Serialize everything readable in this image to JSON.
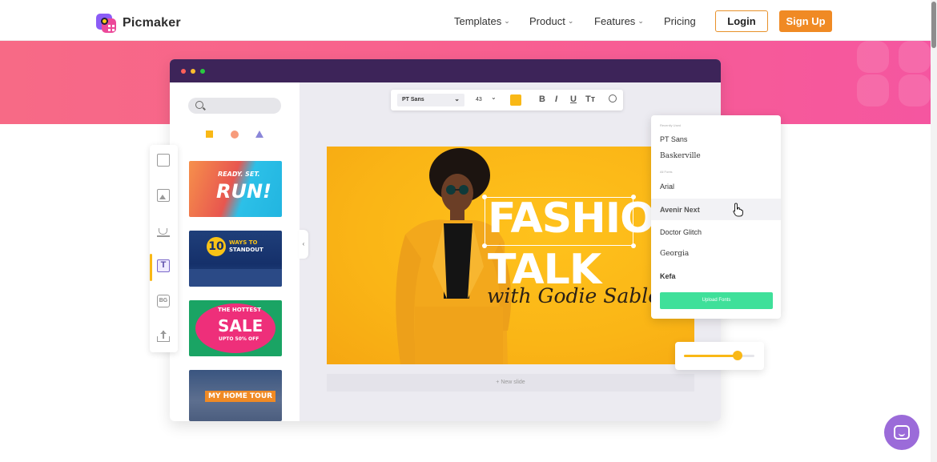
{
  "nav": {
    "brand": "Picmaker",
    "menu": [
      {
        "label": "Templates",
        "has_caret": true
      },
      {
        "label": "Product",
        "has_caret": true
      },
      {
        "label": "Features",
        "has_caret": true
      },
      {
        "label": "Pricing",
        "has_caret": false
      }
    ],
    "login_label": "Login",
    "signup_label": "Sign Up",
    "caret_icon": "chevron-down-icon"
  },
  "colors": {
    "accent_orange": "#f08a24",
    "hero_pink": "#f8608f",
    "window_titlebar": "#3d2459",
    "design_yellow": "#f9b816",
    "upload_green": "#3fe09a",
    "chat_purple": "#9b6bd9"
  },
  "editor": {
    "format_bar": {
      "font": "PT Sans",
      "size": "43",
      "bold_glyph": "B",
      "italic_glyph": "I",
      "underline_glyph": "U",
      "case_glyph": "Tт"
    },
    "templates": [
      {
        "lines": [
          "READY. SET.",
          "RUN!"
        ]
      },
      {
        "lines": [
          "10",
          "WAYS TO",
          "STANDOUT"
        ]
      },
      {
        "lines": [
          "THE HOTTEST",
          "SALE",
          "UPTO 50% OFF"
        ]
      },
      {
        "lines": [
          "MY HOME TOUR"
        ]
      }
    ],
    "design": {
      "headline_1": "FASHION",
      "headline_2": "TALK",
      "script_line": "with Godie Sable"
    },
    "new_slide_label": "New slide",
    "font_panel": {
      "recent_header": "Recently Used",
      "recent": [
        "PT Sans",
        "Baskerville"
      ],
      "all_header": "All Fonts",
      "all": [
        "Arial",
        "Avenir Next",
        "Doctor Glitch",
        "Georgia",
        "Kefa"
      ],
      "hovered": "Avenir Next",
      "upload_label": "Upload Fonts"
    },
    "slider_level": 0.76
  },
  "tools": [
    "page-icon",
    "image-icon",
    "cup-icon",
    "text-icon",
    "background-icon",
    "upload-icon"
  ]
}
